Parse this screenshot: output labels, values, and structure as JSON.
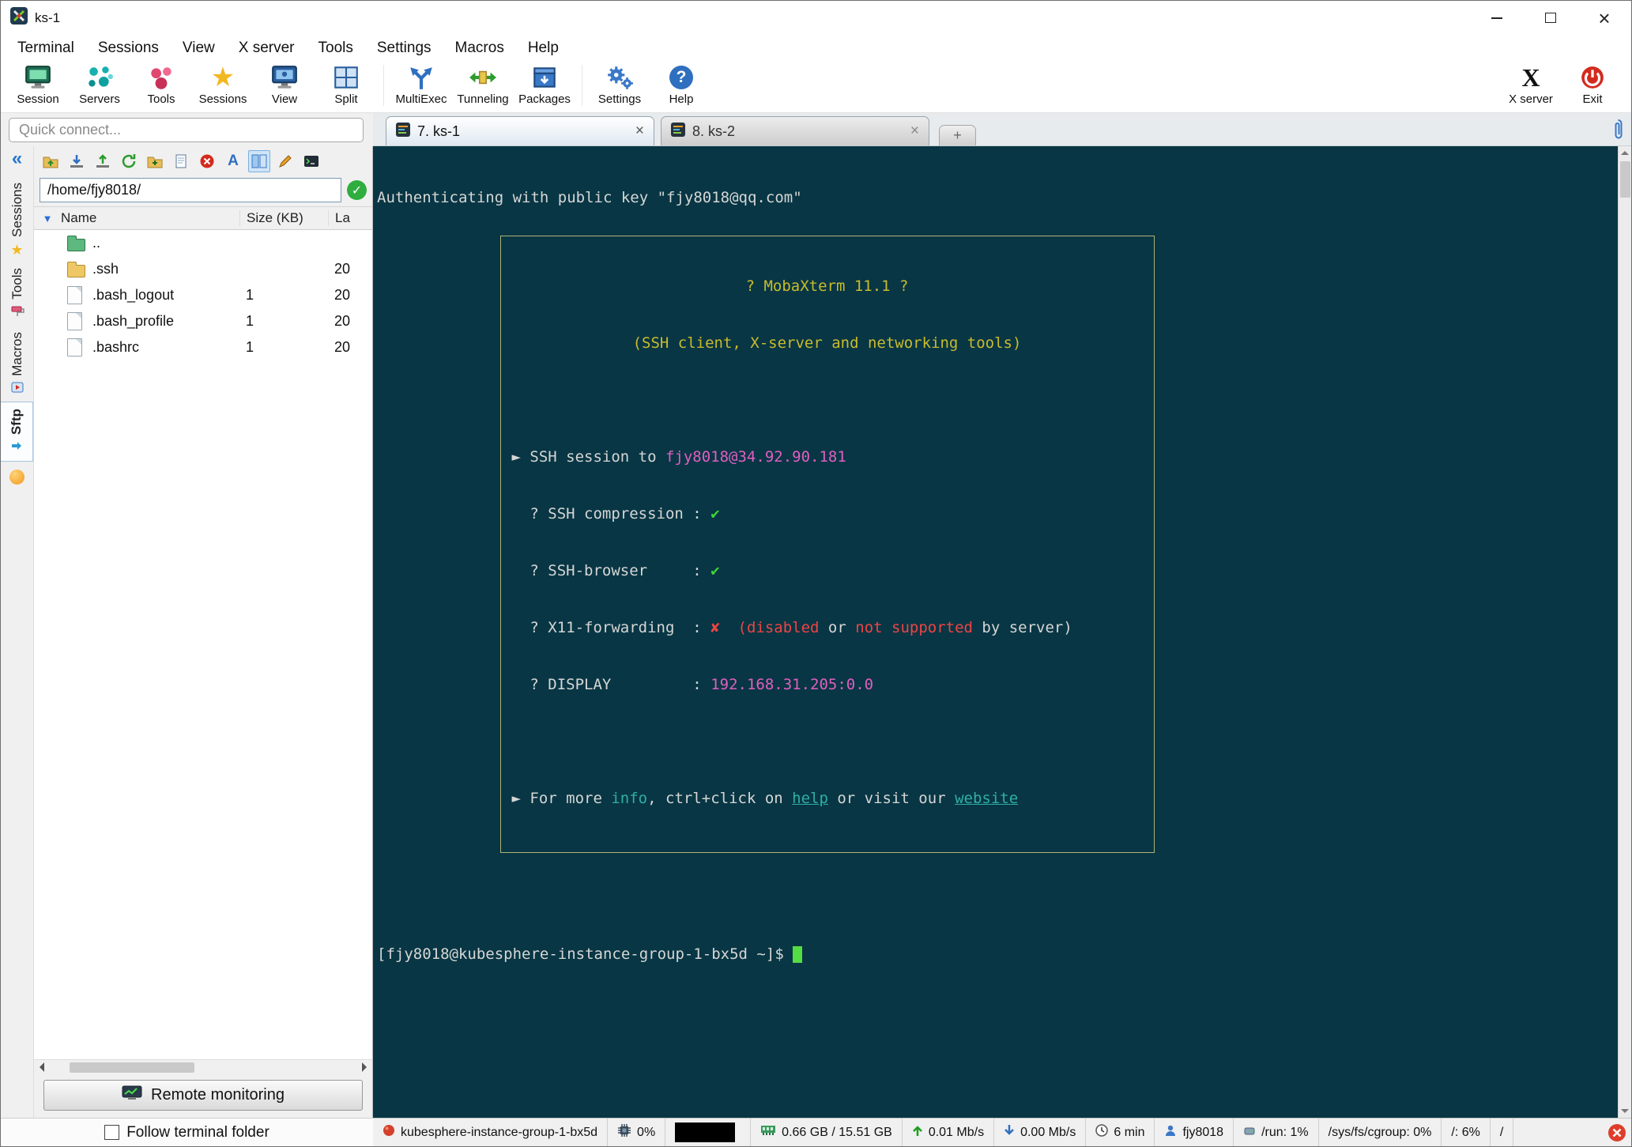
{
  "window": {
    "title": "ks-1"
  },
  "menubar": {
    "items": [
      {
        "label": "Terminal"
      },
      {
        "label": "Sessions"
      },
      {
        "label": "View"
      },
      {
        "label": "X server"
      },
      {
        "label": "Tools"
      },
      {
        "label": "Settings"
      },
      {
        "label": "Macros"
      },
      {
        "label": "Help"
      }
    ]
  },
  "toolbar": {
    "items": [
      {
        "label": "Session"
      },
      {
        "label": "Servers"
      },
      {
        "label": "Tools"
      },
      {
        "label": "Sessions"
      },
      {
        "label": "View"
      },
      {
        "label": "Split"
      },
      {
        "label": "MultiExec"
      },
      {
        "label": "Tunneling"
      },
      {
        "label": "Packages"
      },
      {
        "label": "Settings"
      },
      {
        "label": "Help"
      }
    ],
    "right_items": [
      {
        "label": "X server"
      },
      {
        "label": "Exit"
      }
    ]
  },
  "quick_connect": {
    "placeholder": "Quick connect..."
  },
  "sidebar": {
    "tabs": [
      {
        "label": "Sessions"
      },
      {
        "label": "Tools"
      },
      {
        "label": "Macros"
      },
      {
        "label": "Sftp"
      }
    ]
  },
  "sftp": {
    "path_value": "/home/fjy8018/",
    "columns": {
      "name": "Name",
      "size": "Size (KB)",
      "last": "La"
    },
    "rows": [
      {
        "name": "..",
        "size": "",
        "last": ""
      },
      {
        "name": ".ssh",
        "size": "",
        "last": "20"
      },
      {
        "name": ".bash_logout",
        "size": "1",
        "last": "20"
      },
      {
        "name": ".bash_profile",
        "size": "1",
        "last": "20"
      },
      {
        "name": ".bashrc",
        "size": "1",
        "last": "20"
      }
    ],
    "remote_monitoring_label": "Remote monitoring",
    "follow_terminal_label": "Follow terminal folder"
  },
  "terminal_tabs": [
    {
      "label": "7. ks-1",
      "close": "×"
    },
    {
      "label": "8. ks-2",
      "close": "×"
    }
  ],
  "terminal": {
    "auth_line": "Authenticating with public key \"fjy8018@qq.com\"",
    "banner": {
      "title": "? MobaXterm 11.1 ?",
      "subtitle": "(SSH client, X-server and networking tools)",
      "session_prefix": "► SSH session to ",
      "session_target": "fjy8018@34.92.90.181",
      "compression_label": "  ? SSH compression : ",
      "compression_mark": "✔",
      "browser_label": "  ? SSH-browser     : ",
      "browser_mark": "✔",
      "x11_label": "  ? X11-forwarding  : ",
      "x11_mark": "✘",
      "x11_gap": "  ",
      "x11_disabled": "(disabled",
      "x11_or": " or ",
      "x11_notsupported": "not supported",
      "x11_rest": " by server)",
      "display_label": "  ? DISPLAY         : ",
      "display_value": "192.168.31.205:0.0",
      "info_1": "► For more ",
      "info_link1": "info",
      "info_2": ", ctrl+click on ",
      "info_link2": "help",
      "info_3": " or visit our ",
      "info_link3": "website"
    },
    "prompt": "[fjy8018@kubesphere-instance-group-1-bx5d ~]$ "
  },
  "statusbar": {
    "segments": [
      {
        "label": "kubesphere-instance-group-1-bx5d",
        "icon": "server-icon"
      },
      {
        "label": "0%",
        "icon": "cpu-icon"
      },
      {
        "label": "",
        "icon": "activity-graph"
      },
      {
        "label": "0.66 GB / 15.51 GB",
        "icon": "memory-icon"
      },
      {
        "label": "0.01 Mb/s",
        "icon": "upload-arrow-icon"
      },
      {
        "label": "0.00 Mb/s",
        "icon": "download-arrow-icon"
      },
      {
        "label": "6 min",
        "icon": "clock-icon"
      },
      {
        "label": "fjy8018",
        "icon": "user-icon"
      },
      {
        "label": "/run: 1%",
        "icon": "disk-icon"
      },
      {
        "label": "/sys/fs/cgroup: 0%"
      },
      {
        "label": "/: 6%"
      },
      {
        "label": "/"
      }
    ]
  },
  "colors": {
    "terminal_bg": "#083644",
    "terminal_fg": "#d6d6d6",
    "banner_yellow": "#c9bb2e",
    "magenta": "#df5fc0",
    "green": "#3ed43e",
    "red": "#ee4444",
    "cyan": "#2fafa6",
    "cursor_green": "#55dd44",
    "selection_blue": "#cfe4f7"
  }
}
